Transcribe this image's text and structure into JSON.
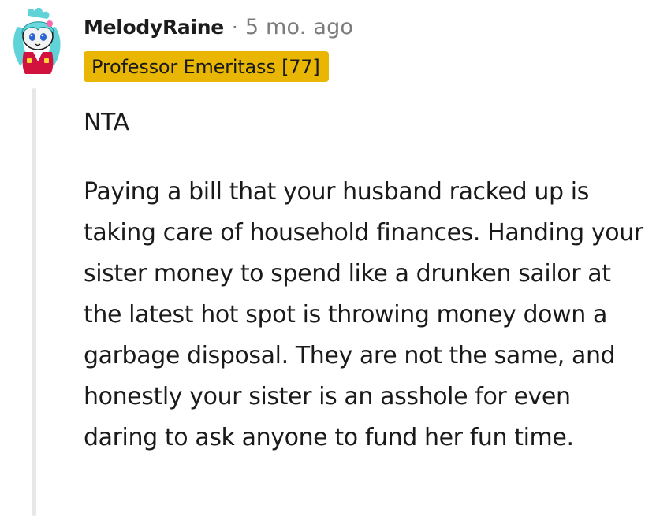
{
  "comment": {
    "author": {
      "username": "MelodyRaine",
      "avatar": "snoo-avatar-cyan-hair-red-outfit"
    },
    "separator": "·",
    "timestamp": "5 mo. ago",
    "flair": {
      "text": "Professor Emeritass [77]",
      "background_color": "#e9b703"
    },
    "body": {
      "verdict": "NTA",
      "paragraph": "Paying a bill that your husband racked up is taking care of household finances. Handing your sister money to spend like a drunken sailor at the latest hot spot is throwing money down a garbage disposal. They are not the same, and honestly your sister is an asshole for even daring to ask anyone to fund her fun time."
    }
  }
}
